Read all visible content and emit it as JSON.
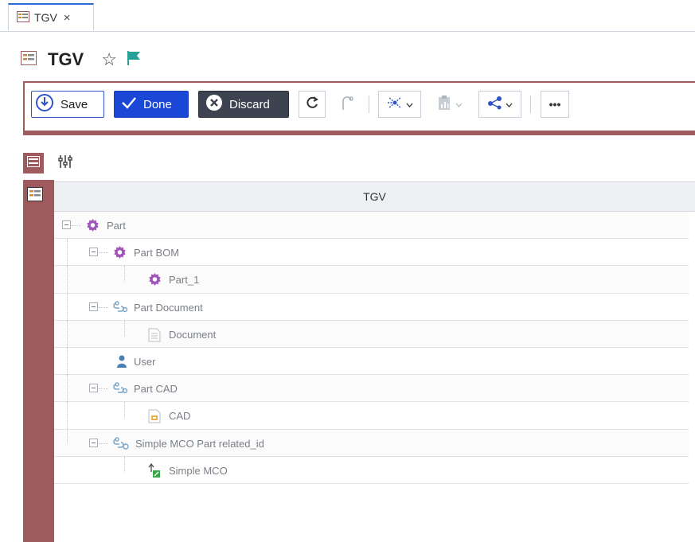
{
  "tab": {
    "label": "TGV",
    "close": "×"
  },
  "title": {
    "text": "TGV"
  },
  "toolbar": {
    "save_label": "Save",
    "done_label": "Done",
    "discard_label": "Discard",
    "more_label": "•••"
  },
  "grid": {
    "header": "TGV",
    "rows": [
      {
        "label": "Part",
        "icon": "gear-icon"
      },
      {
        "label": "Part BOM",
        "icon": "gear-icon"
      },
      {
        "label": "Part_1",
        "icon": "gear-icon"
      },
      {
        "label": "Part Document",
        "icon": "relationship-icon"
      },
      {
        "label": "Document",
        "icon": "document-icon"
      },
      {
        "label": "User",
        "icon": "user-icon"
      },
      {
        "label": "Part CAD",
        "icon": "relationship-icon"
      },
      {
        "label": "CAD",
        "icon": "cad-icon"
      },
      {
        "label": "Simple MCO Part related_id",
        "icon": "relationship-icon"
      },
      {
        "label": "Simple MCO",
        "icon": "mco-icon"
      }
    ]
  },
  "colors": {
    "accent": "#9e5a5d",
    "primary_button": "#1a47d6",
    "discard_button": "#3d4350",
    "flag": "#2aa198",
    "gear": "#a055b8"
  }
}
